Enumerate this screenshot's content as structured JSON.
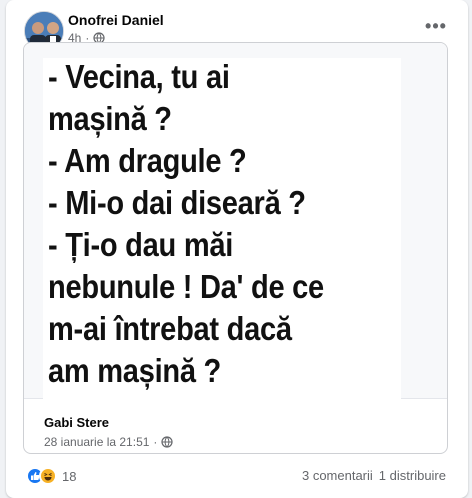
{
  "post": {
    "author": "Onofrei Daniel",
    "time": "4h",
    "separator": "·",
    "more_label": "•••",
    "meme_lines": [
      "- Vecina, tu ai",
      "mașină ?",
      "- Am dragule ?",
      "- Mi-o dai diseară ?",
      "- Ți-o dau măi",
      "nebunule ! Da' de ce",
      "m-ai întrebat dacă",
      "am mașină ?"
    ],
    "shared_source": {
      "name": "Gabi Stere",
      "time": "28 ianuarie la 21:51",
      "separator": "·"
    }
  },
  "footer": {
    "reaction_count": "18",
    "comments": "3 comentarii",
    "shares": "1 distribuire"
  },
  "colors": {
    "like": "#1877f2",
    "haha": "#f7b125",
    "secondary_text": "#65676b"
  },
  "icons": {
    "audience": "globe-icon",
    "like": "like-icon",
    "haha": "haha-icon",
    "more": "more-options-icon"
  }
}
